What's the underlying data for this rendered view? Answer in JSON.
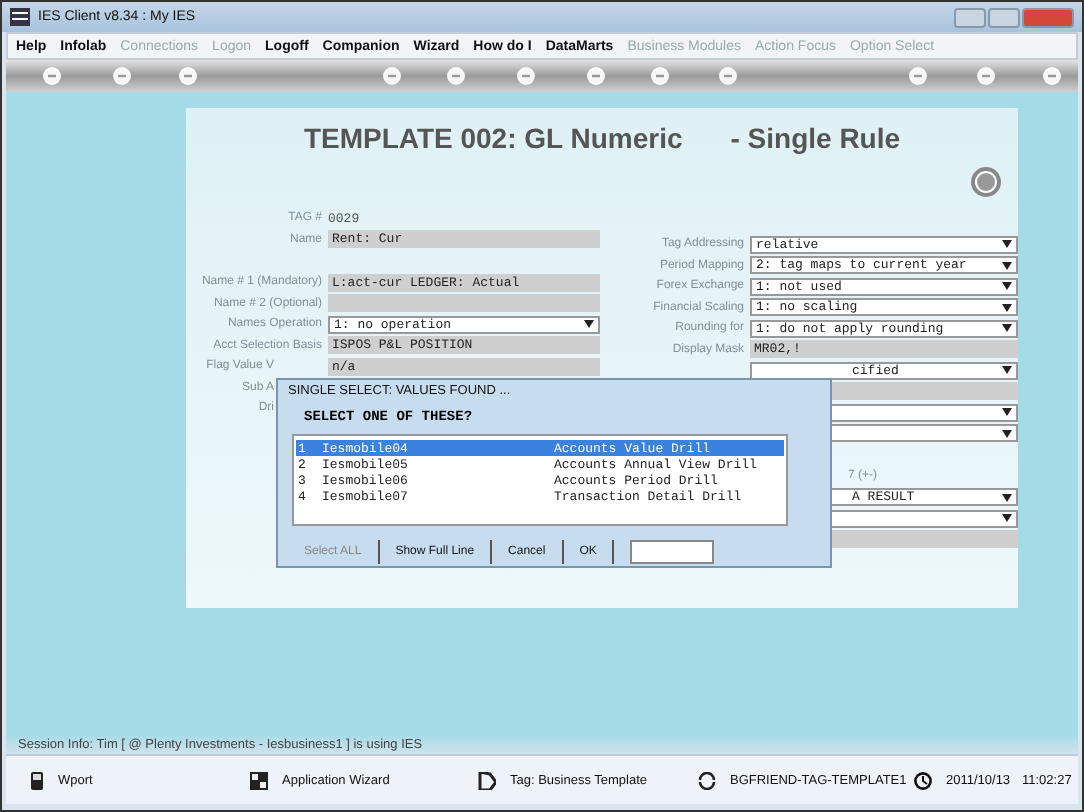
{
  "window": {
    "title": "IES Client v8.34 : My IES"
  },
  "menu": [
    {
      "label": "Help",
      "disabled": false
    },
    {
      "label": "Infolab",
      "disabled": false
    },
    {
      "label": "Connections",
      "disabled": true
    },
    {
      "label": "Logon",
      "disabled": true
    },
    {
      "label": "Logoff",
      "disabled": false
    },
    {
      "label": "Companion",
      "disabled": false
    },
    {
      "label": "Wizard",
      "disabled": false
    },
    {
      "label": "How do I",
      "disabled": false
    },
    {
      "label": "DataMarts",
      "disabled": false
    },
    {
      "label": "Business Modules",
      "disabled": true
    },
    {
      "label": "Action Focus",
      "disabled": true
    },
    {
      "label": "Option Select",
      "disabled": true
    }
  ],
  "form": {
    "title": "TEMPLATE 002: GL Numeric",
    "subtitle": "- Single Rule",
    "left_groups": [
      [
        {
          "label": "TAG #",
          "value": "0029",
          "kind": "plain",
          "partly_covered": false
        },
        {
          "label": "Name",
          "value": "Rent: Cur",
          "kind": "text",
          "partly_covered": false
        }
      ],
      [
        {
          "label": "Name # 1 (Mandatory)",
          "value": "L:act-cur LEDGER: Actual",
          "kind": "text",
          "partly_covered": false
        },
        {
          "label": "Name # 2 (Optional)",
          "kind": "text",
          "partly_covered": false
        },
        {
          "label": "Names Operation",
          "value": "1: no operation",
          "kind": "select",
          "partly_covered": false
        },
        {
          "label": "Acct Selection Basis",
          "value": "ISPOS P&L POSITION",
          "kind": "text",
          "partly_covered": false
        },
        {
          "label": "Flag Value V",
          "value": "n/a",
          "kind": "text",
          "partly_covered": true
        },
        {
          "label": "Sub A",
          "kind": "plain",
          "partly_covered": true
        },
        {
          "label": "Dri",
          "kind": "plain",
          "partly_covered": true
        }
      ]
    ],
    "right_groups": [
      [
        {
          "label": "Tag Addressing",
          "value": "relative",
          "kind": "select",
          "partly_covered": false
        },
        {
          "label": "Period Mapping",
          "value": "2: tag maps to current year",
          "kind": "select",
          "partly_covered": false
        },
        {
          "label": "Forex Exchange",
          "value": "1: not used",
          "kind": "select",
          "partly_covered": false
        },
        {
          "label": "Financial Scaling",
          "value": "1: no scaling",
          "kind": "select",
          "partly_covered": false
        },
        {
          "label": "Rounding for",
          "value": "1: do not apply rounding",
          "kind": "select",
          "partly_covered": false
        },
        {
          "label": "Display Mask",
          "value": "MR02,!",
          "kind": "text",
          "partly_covered": false
        },
        {
          "value": "cified",
          "kind": "select",
          "partly_covered": true
        },
        {
          "kind": "text",
          "partly_covered": false
        },
        {
          "kind": "select",
          "partly_covered": false
        },
        {
          "kind": "select",
          "partly_covered": false
        }
      ],
      [
        {
          "label": "7 (+-)",
          "kind": "plain",
          "partly_covered": true
        },
        {
          "value": "A RESULT",
          "kind": "select",
          "partly_covered": true
        },
        {
          "kind": "select",
          "partly_covered": false
        },
        {
          "kind": "text",
          "partly_covered": false
        }
      ]
    ]
  },
  "dialog": {
    "title": "SINGLE SELECT: VALUES FOUND ...",
    "prompt": "SELECT ONE OF THESE?",
    "items": [
      {
        "number": "1",
        "code": "Iesmobile04",
        "description": "Accounts Value Drill",
        "selected": true
      },
      {
        "number": "2",
        "code": "Iesmobile05",
        "description": "Accounts Annual View Drill",
        "selected": false
      },
      {
        "number": "3",
        "code": "Iesmobile06",
        "description": "Accounts Period Drill",
        "selected": false
      },
      {
        "number": "4",
        "code": "Iesmobile07",
        "description": "Transaction Detail Drill",
        "selected": false
      }
    ],
    "buttons": [
      {
        "label": "Select ALL",
        "disabled": true
      },
      {
        "label": "Show Full Line",
        "disabled": false
      },
      {
        "label": "Cancel",
        "disabled": false
      },
      {
        "label": "OK",
        "disabled": false
      }
    ]
  },
  "session_info": "Session Info: Tim [ @ Plenty Investments   - Iesbusiness1 ] is using IES",
  "status_bar": [
    {
      "kind": "phone",
      "label": "Wport"
    },
    {
      "kind": "wizard",
      "label": "Application Wizard"
    },
    {
      "kind": "tag",
      "label": "Tag: Business Template"
    },
    {
      "kind": "sync",
      "label": "BGFRIEND-TAG-TEMPLATE1"
    },
    {
      "kind": "clock",
      "label": "2011/10/13"
    },
    {
      "kind": "time",
      "label": "11:02:27"
    }
  ]
}
